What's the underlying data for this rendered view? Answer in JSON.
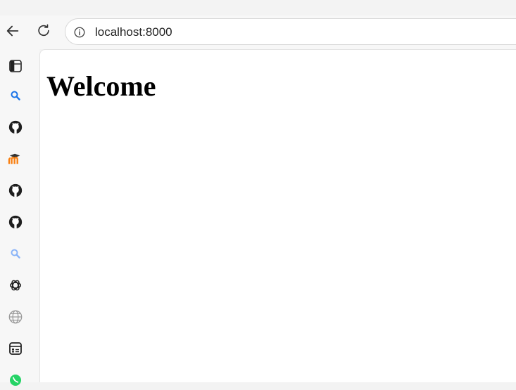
{
  "browser": {
    "address": "localhost:8000"
  },
  "sidebar": {
    "icons": [
      "sidebar-toggle-icon",
      "search-icon",
      "github-icon",
      "moodle-icon",
      "github-icon",
      "github-icon",
      "search-icon",
      "chatgpt-icon",
      "globe-icon",
      "app-icon",
      "whatsapp-icon"
    ]
  },
  "page": {
    "heading": "Welcome"
  },
  "colors": {
    "search_blue": "#1a73e8",
    "search_light_blue": "#8ab4f8",
    "moodle_orange": "#f98012",
    "whatsapp_green": "#25d366"
  }
}
